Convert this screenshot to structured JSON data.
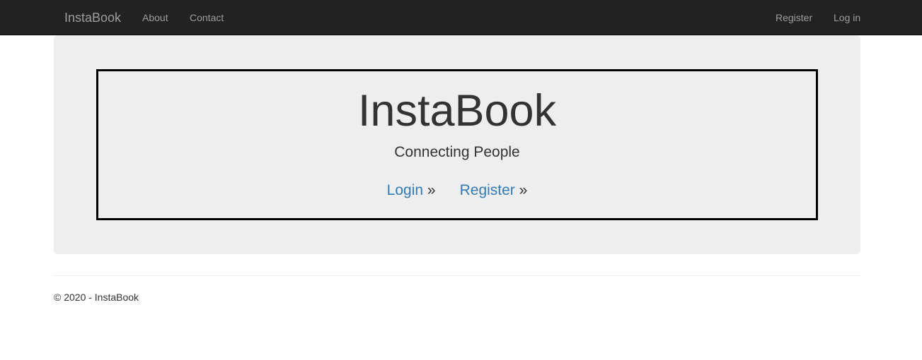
{
  "navbar": {
    "brand": "InstaBook",
    "left_links": [
      "About",
      "Contact"
    ],
    "right_links": [
      "Register",
      "Log in"
    ],
    "background": "#222222",
    "link_color": "#9d9d9d"
  },
  "hero": {
    "title": "InstaBook",
    "tagline": "Connecting People",
    "login_label": "Login",
    "register_label": "Register",
    "arrow": "»",
    "link_color": "#337ab7",
    "panel_background": "#eeeeee"
  },
  "footer": {
    "text": "© 2020 - InstaBook"
  }
}
